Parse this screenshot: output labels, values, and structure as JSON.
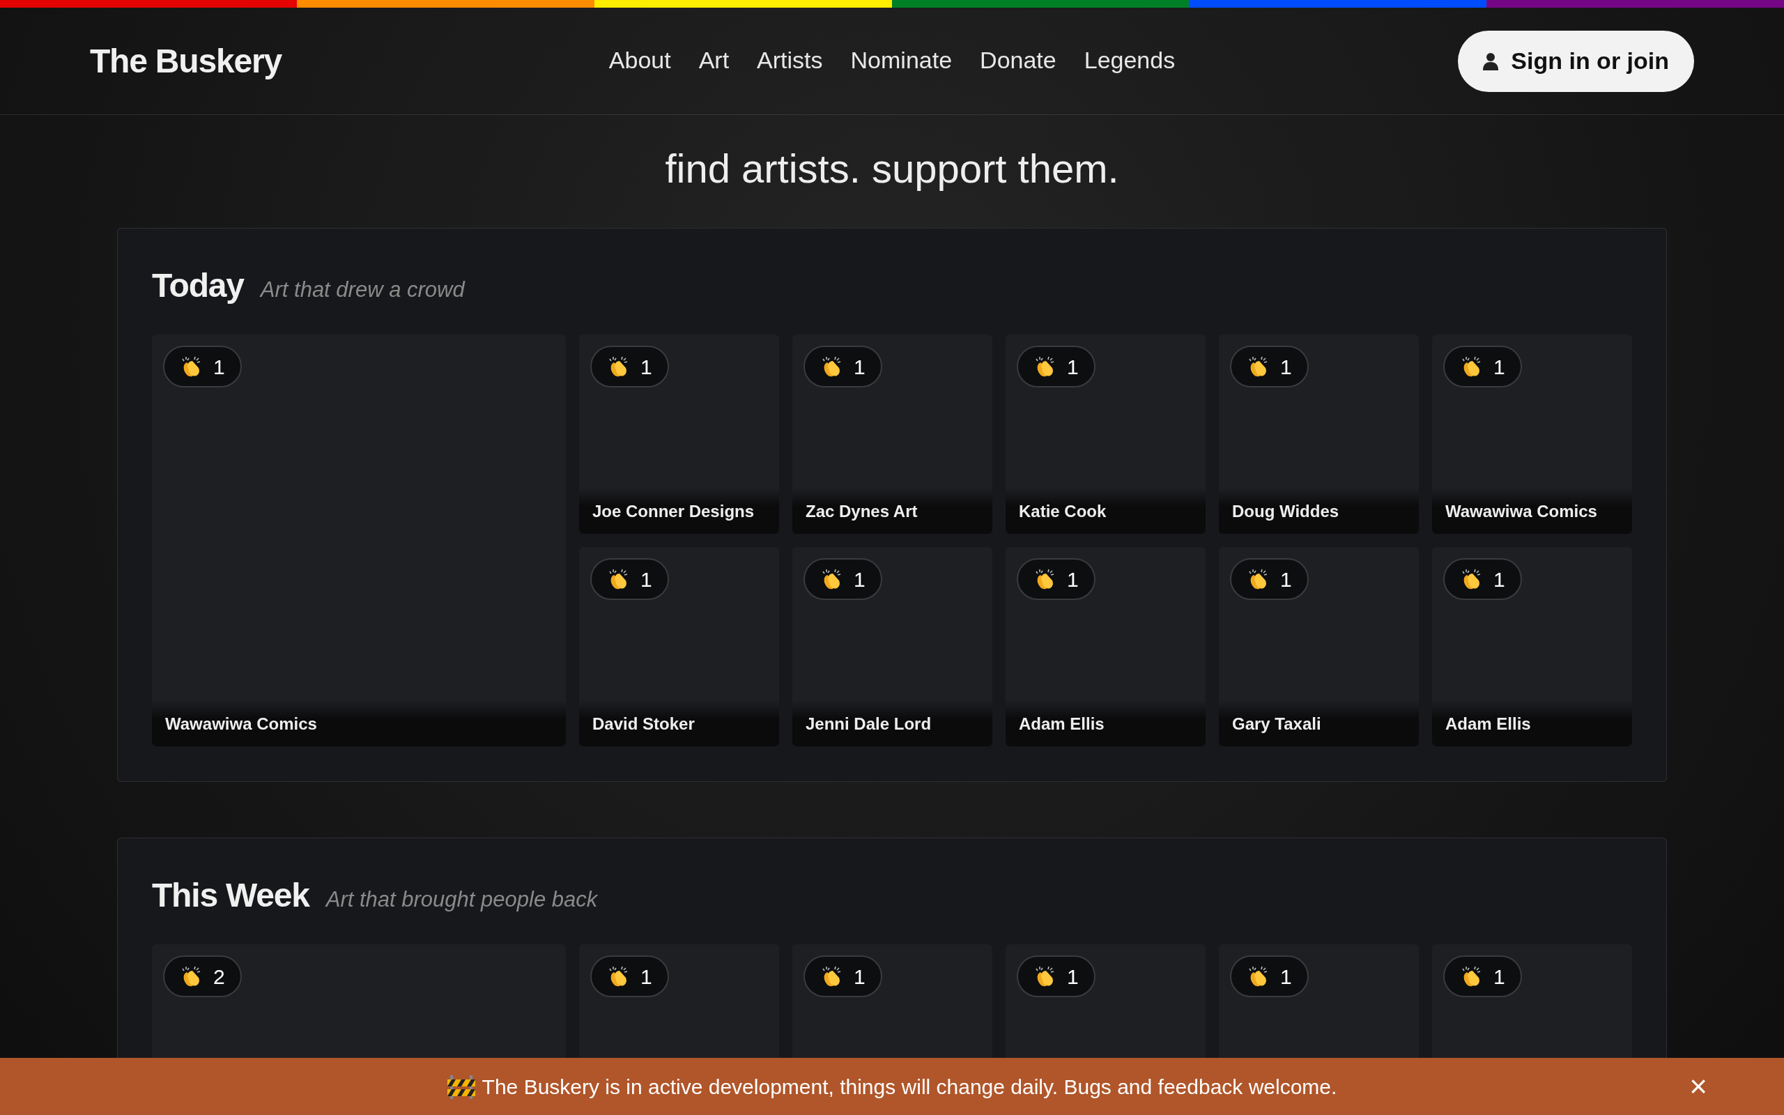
{
  "header": {
    "logo": "The Buskery",
    "nav": [
      {
        "label": "About"
      },
      {
        "label": "Art"
      },
      {
        "label": "Artists"
      },
      {
        "label": "Nominate"
      },
      {
        "label": "Donate"
      },
      {
        "label": "Legends"
      }
    ],
    "sign_in": "Sign in or join"
  },
  "tagline": "find artists. support them.",
  "sections": [
    {
      "title": "Today",
      "subtitle": "Art that drew a crowd",
      "tiles": [
        {
          "claps": "1",
          "artist": "Wawawiwa Comics"
        },
        {
          "claps": "1",
          "artist": "Joe Conner Designs"
        },
        {
          "claps": "1",
          "artist": "Zac Dynes Art"
        },
        {
          "claps": "1",
          "artist": "Katie Cook"
        },
        {
          "claps": "1",
          "artist": "Doug Widdes"
        },
        {
          "claps": "1",
          "artist": "Wawawiwa Comics"
        },
        {
          "claps": "1",
          "artist": "David Stoker"
        },
        {
          "claps": "1",
          "artist": "Jenni Dale Lord"
        },
        {
          "claps": "1",
          "artist": "Adam Ellis"
        },
        {
          "claps": "1",
          "artist": "Gary Taxali"
        },
        {
          "claps": "1",
          "artist": "Adam Ellis"
        }
      ]
    },
    {
      "title": "This Week",
      "subtitle": "Art that brought people back",
      "tiles": [
        {
          "claps": "2"
        },
        {
          "claps": "1"
        },
        {
          "claps": "1"
        },
        {
          "claps": "1"
        },
        {
          "claps": "1"
        },
        {
          "claps": "1"
        }
      ]
    }
  ],
  "banner": {
    "text": "The Buskery is in active development, things will change daily. Bugs and feedback welcome.",
    "close": "×"
  }
}
